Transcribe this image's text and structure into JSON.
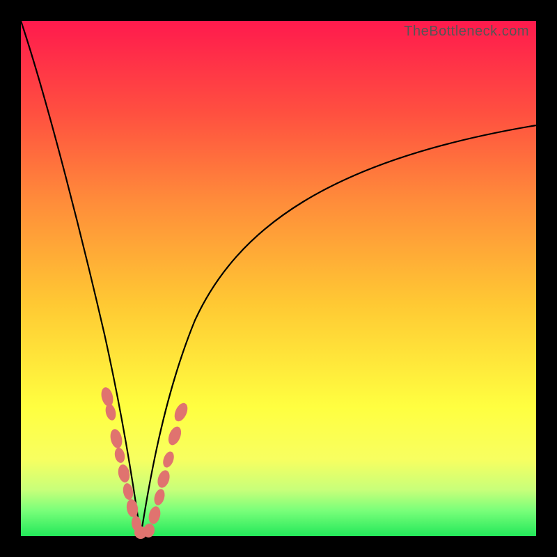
{
  "watermark": "TheBottleneck.com",
  "colors": {
    "frame": "#000000",
    "curve": "#000000",
    "bead": "#e0736f",
    "gradient_top": "#ff1a4d",
    "gradient_bottom": "#23e85a"
  },
  "chart_data": {
    "type": "line",
    "title": "",
    "xlabel": "",
    "ylabel": "",
    "xlim": [
      0,
      100
    ],
    "ylim": [
      0,
      100
    ],
    "note": "No axes or tick labels visible; y ~ bottleneck % (high at top, 0 at bottom), x ~ component balance. Values estimated from curve pixels.",
    "series": [
      {
        "name": "left-branch",
        "x": [
          0,
          3,
          6,
          9,
          12,
          15,
          17,
          19,
          20,
          21.5,
          23
        ],
        "y": [
          100,
          85,
          70,
          55,
          42,
          30,
          22,
          15,
          10,
          5,
          0
        ]
      },
      {
        "name": "right-branch",
        "x": [
          23,
          25,
          27,
          30,
          34,
          40,
          48,
          58,
          70,
          84,
          100
        ],
        "y": [
          0,
          6,
          14,
          25,
          38,
          50,
          60,
          68,
          74,
          78,
          80
        ]
      }
    ],
    "markers": {
      "name": "highlighted-points",
      "points": [
        {
          "x": 16.0,
          "y": 27
        },
        {
          "x": 16.8,
          "y": 23
        },
        {
          "x": 18.0,
          "y": 17
        },
        {
          "x": 18.6,
          "y": 14
        },
        {
          "x": 19.5,
          "y": 10
        },
        {
          "x": 20.3,
          "y": 7
        },
        {
          "x": 21.1,
          "y": 4
        },
        {
          "x": 22.0,
          "y": 1.5
        },
        {
          "x": 23.0,
          "y": 0.5
        },
        {
          "x": 24.0,
          "y": 1.0
        },
        {
          "x": 25.5,
          "y": 4
        },
        {
          "x": 26.5,
          "y": 9
        },
        {
          "x": 27.3,
          "y": 13
        },
        {
          "x": 28.2,
          "y": 17
        },
        {
          "x": 29.5,
          "y": 22
        },
        {
          "x": 30.5,
          "y": 26
        }
      ]
    }
  }
}
